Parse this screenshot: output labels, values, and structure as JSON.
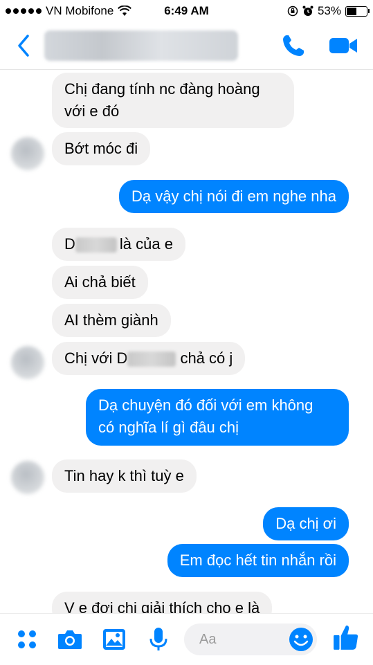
{
  "status_bar": {
    "carrier": "VN Mobifone",
    "time": "6:49 AM",
    "battery": "53%",
    "battery_level": 0.53
  },
  "header": {
    "back_icon": "chevron-left-icon",
    "call_icon": "phone-icon",
    "video_icon": "video-camera-icon",
    "accent_color": "#0084ff"
  },
  "messages": [
    {
      "side": "in",
      "lines": [
        "Chị đang tính nc đàng hoàng",
        "với e đó"
      ]
    },
    {
      "side": "in",
      "text": "Bớt móc đi"
    },
    {
      "side": "out",
      "text": "Dạ vậy chị nói đi em nghe nha"
    },
    {
      "side": "in",
      "pre": "D",
      "post": "là của e"
    },
    {
      "side": "in",
      "text": "Ai chả biết"
    },
    {
      "side": "in",
      "text": "AI thèm giành"
    },
    {
      "side": "in",
      "pre": "Chị với D",
      "post": "chả có j"
    },
    {
      "side": "out",
      "lines": [
        "Dạ chuyện đó đối với em không",
        "có nghĩa lí gì đâu chị"
      ]
    },
    {
      "side": "in",
      "text": "Tin hay k thì tuỳ e"
    },
    {
      "side": "out",
      "text": "Dạ chị ơi"
    },
    {
      "side": "out",
      "text": "Em đọc hết tin nhắn rồi"
    },
    {
      "side": "in",
      "text": "V e đợi chị giải thích cho e là"
    }
  ],
  "composer": {
    "placeholder": "Aa",
    "icons": [
      "more-apps-icon",
      "camera-icon",
      "gallery-icon",
      "microphone-icon",
      "emoji-icon",
      "thumbs-up-icon"
    ]
  }
}
